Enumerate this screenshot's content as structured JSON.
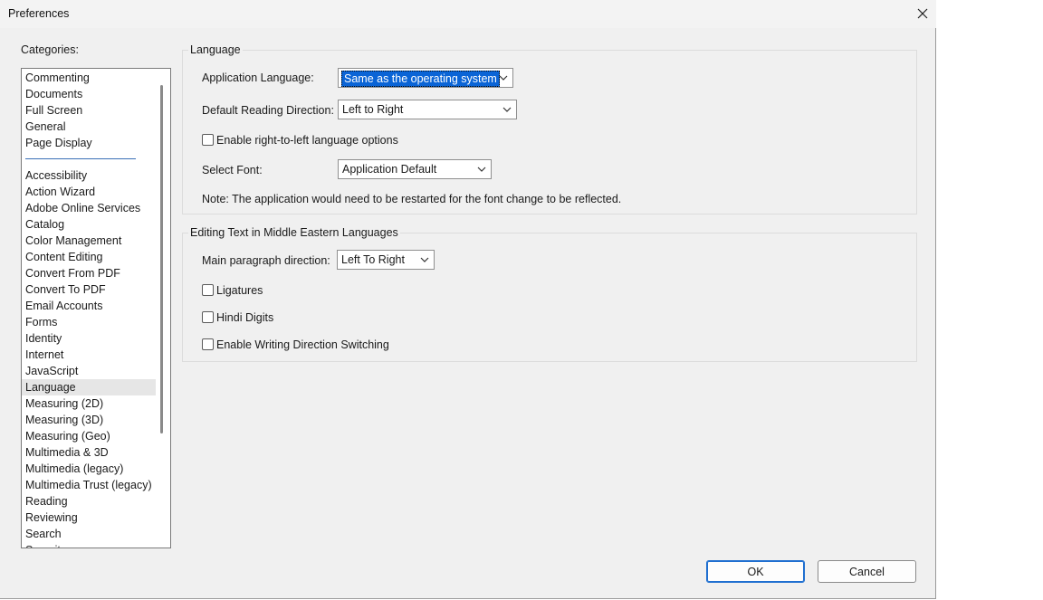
{
  "window": {
    "title": "Preferences",
    "close_icon": "close-icon"
  },
  "sidebar": {
    "label": "Categories:",
    "top_items": [
      {
        "label": "Commenting"
      },
      {
        "label": "Documents"
      },
      {
        "label": "Full Screen"
      },
      {
        "label": "General"
      },
      {
        "label": "Page Display"
      }
    ],
    "items": [
      {
        "label": "Accessibility"
      },
      {
        "label": "Action Wizard"
      },
      {
        "label": "Adobe Online Services"
      },
      {
        "label": "Catalog"
      },
      {
        "label": "Color Management"
      },
      {
        "label": "Content Editing"
      },
      {
        "label": "Convert From PDF"
      },
      {
        "label": "Convert To PDF"
      },
      {
        "label": "Email Accounts"
      },
      {
        "label": "Forms"
      },
      {
        "label": "Identity"
      },
      {
        "label": "Internet"
      },
      {
        "label": "JavaScript"
      },
      {
        "label": "Language"
      },
      {
        "label": "Measuring (2D)"
      },
      {
        "label": "Measuring (3D)"
      },
      {
        "label": "Measuring (Geo)"
      },
      {
        "label": "Multimedia & 3D"
      },
      {
        "label": "Multimedia (legacy)"
      },
      {
        "label": "Multimedia Trust (legacy)"
      },
      {
        "label": "Reading"
      },
      {
        "label": "Reviewing"
      },
      {
        "label": "Search"
      },
      {
        "label": "Security"
      }
    ],
    "selected": "Language"
  },
  "language_group": {
    "title": "Language",
    "app_language_label": "Application Language:",
    "app_language_value": "Same as the operating system",
    "reading_direction_label": "Default Reading Direction:",
    "reading_direction_value": "Left to Right",
    "rtl_checkbox_label": "Enable right-to-left language options",
    "rtl_checked": false,
    "font_label": "Select Font:",
    "font_value": "Application Default",
    "note": "Note: The application would need to be restarted for the font change to be reflected."
  },
  "middle_east_group": {
    "title": "Editing Text in Middle Eastern Languages",
    "paragraph_direction_label": "Main paragraph direction:",
    "paragraph_direction_value": "Left To Right",
    "ligatures_label": "Ligatures",
    "ligatures_checked": false,
    "hindi_digits_label": "Hindi Digits",
    "hindi_digits_checked": false,
    "writing_direction_label": "Enable Writing Direction Switching",
    "writing_direction_checked": false
  },
  "footer": {
    "ok_label": "OK",
    "cancel_label": "Cancel"
  },
  "colors": {
    "selection": "#0a64d6",
    "accent_border": "#1f6fd0",
    "separator": "#3a6fb6",
    "dialog_bg": "#f0f0f0"
  }
}
